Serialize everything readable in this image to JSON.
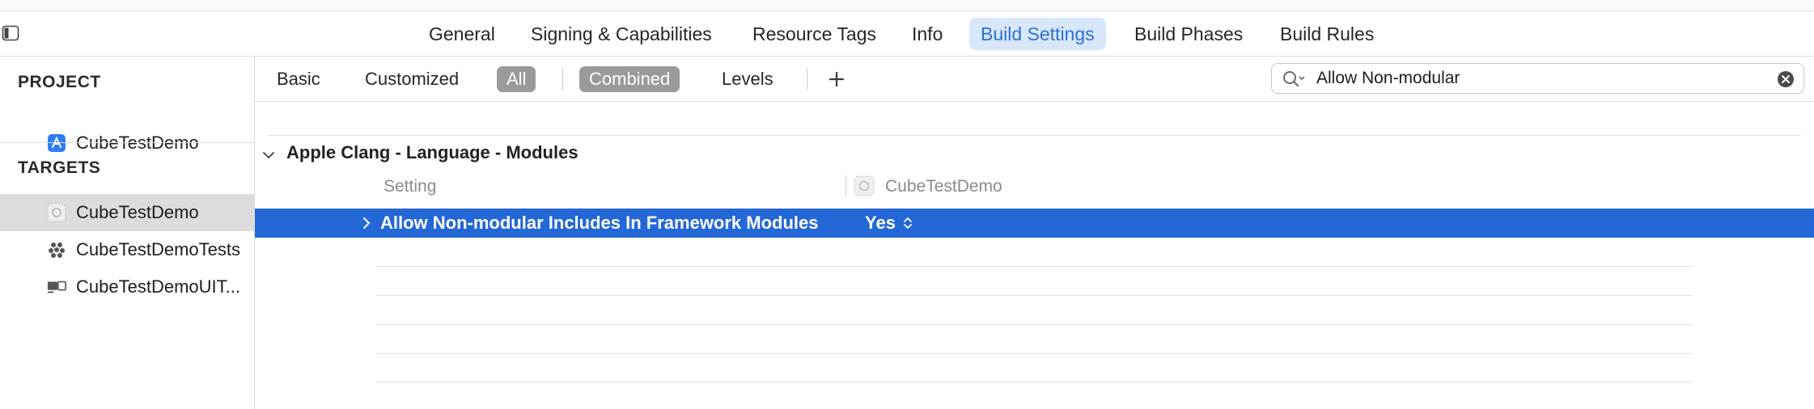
{
  "tabs": [
    {
      "label": "General",
      "active": false
    },
    {
      "label": "Signing & Capabilities",
      "active": false
    },
    {
      "label": "Resource Tags",
      "active": false
    },
    {
      "label": "Info",
      "active": false
    },
    {
      "label": "Build Settings",
      "active": true
    },
    {
      "label": "Build Phases",
      "active": false
    },
    {
      "label": "Build Rules",
      "active": false
    }
  ],
  "sidebar": {
    "project_header": "PROJECT",
    "project_item": {
      "label": "CubeTestDemo",
      "icon": "app-project-icon"
    },
    "targets_header": "TARGETS",
    "targets": [
      {
        "label": "CubeTestDemo",
        "icon": "app-target-icon",
        "selected": true
      },
      {
        "label": "CubeTestDemoTests",
        "icon": "unit-tests-icon",
        "selected": false
      },
      {
        "label": "CubeTestDemoUIT...",
        "icon": "ui-tests-icon",
        "selected": false
      }
    ]
  },
  "filters": {
    "basic": "Basic",
    "customized": "Customized",
    "all": "All",
    "combined": "Combined",
    "levels": "Levels"
  },
  "search": {
    "value": "Allow Non-modular"
  },
  "group": {
    "title": "Apple Clang - Language - Modules"
  },
  "columns": {
    "setting": "Setting",
    "target": "CubeTestDemo"
  },
  "setting_row": {
    "name": "Allow Non-modular Includes In Framework Modules",
    "value": "Yes",
    "selected": true
  },
  "colors": {
    "accent": "#2468d8",
    "active_tab_bg": "#d9e7fb",
    "active_tab_text": "#2a6fd6",
    "pill_bg": "#9a9a9a",
    "selected_sidebar_bg": "#dcdcdc"
  }
}
